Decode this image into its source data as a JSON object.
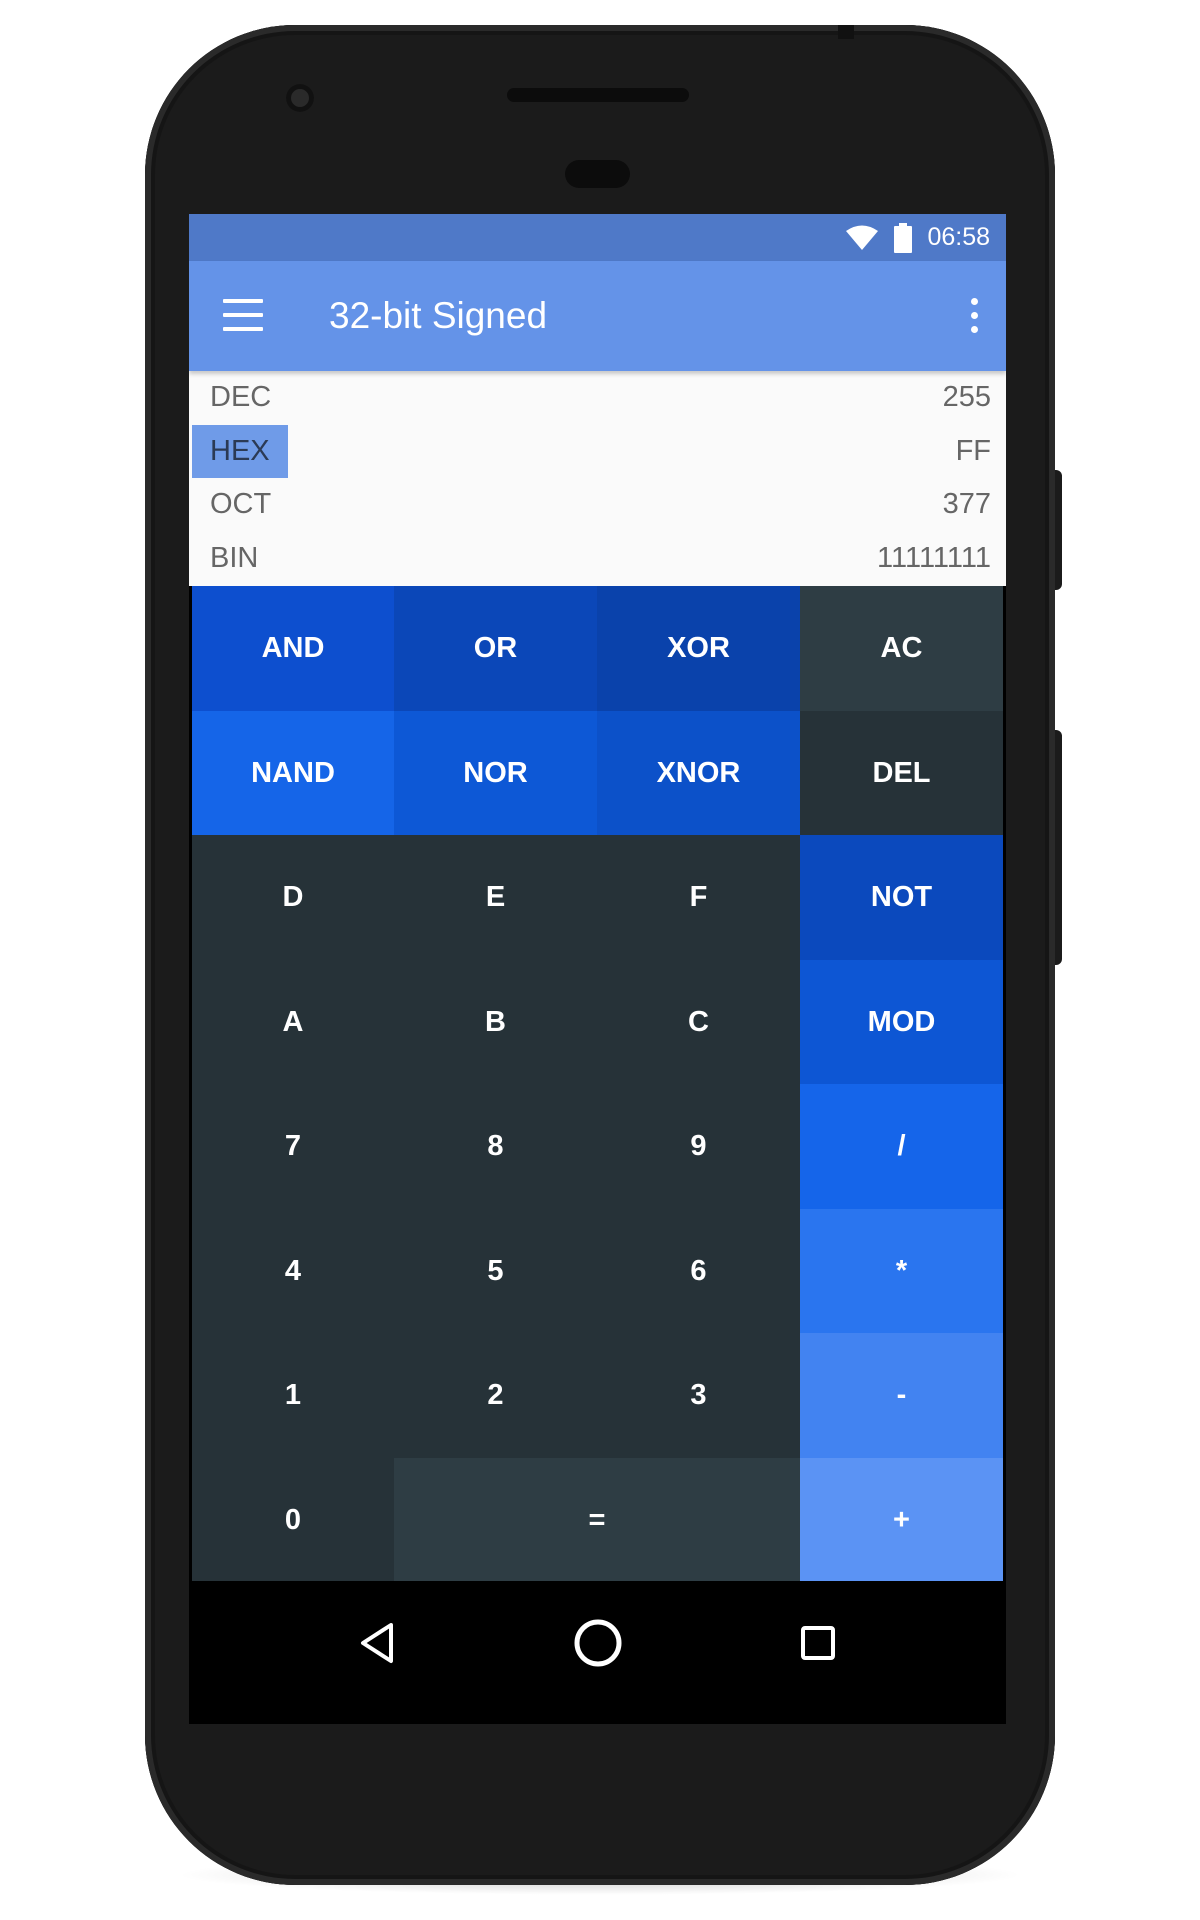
{
  "status_bar": {
    "time": "06:58",
    "icons": [
      "wifi-icon",
      "battery-icon"
    ],
    "background_color": "#4f79c8"
  },
  "app_bar": {
    "title": "32-bit Signed",
    "menu_icon": "hamburger-menu-icon",
    "overflow_icon": "more-vertical-icon",
    "background_color": "#6493e8"
  },
  "display": {
    "rows": [
      {
        "label": "DEC",
        "value": "255",
        "selected": false
      },
      {
        "label": "HEX",
        "value": "FF",
        "selected": true
      },
      {
        "label": "OCT",
        "value": "377",
        "selected": false
      },
      {
        "label": "BIN",
        "value": "11111111",
        "selected": false
      }
    ]
  },
  "keypad": {
    "rows": [
      {
        "keys": [
          {
            "label": "AND",
            "name": "and-key",
            "color": "#0d4fcf"
          },
          {
            "label": "OR",
            "name": "or-key",
            "color": "#0b47b8"
          },
          {
            "label": "XOR",
            "name": "xor-key",
            "color": "#0a42ab"
          },
          {
            "label": "AC",
            "name": "ac-key",
            "color": "#2e3d44"
          }
        ]
      },
      {
        "keys": [
          {
            "label": "NAND",
            "name": "nand-key",
            "color": "#1565e8"
          },
          {
            "label": "NOR",
            "name": "nor-key",
            "color": "#0d58d6"
          },
          {
            "label": "XNOR",
            "name": "xnor-key",
            "color": "#0c51c9"
          },
          {
            "label": "DEL",
            "name": "del-key",
            "color": "#263238"
          }
        ]
      },
      {
        "keys": [
          {
            "label": "D",
            "name": "d-key",
            "color": "#263238"
          },
          {
            "label": "E",
            "name": "e-key",
            "color": "#263238"
          },
          {
            "label": "F",
            "name": "f-key",
            "color": "#263238"
          },
          {
            "label": "NOT",
            "name": "not-key",
            "color": "#0b49bd"
          }
        ]
      },
      {
        "keys": [
          {
            "label": "A",
            "name": "a-key",
            "color": "#263238"
          },
          {
            "label": "B",
            "name": "b-key",
            "color": "#263238"
          },
          {
            "label": "C",
            "name": "c-key",
            "color": "#263238"
          },
          {
            "label": "MOD",
            "name": "mod-key",
            "color": "#0d56d4"
          }
        ]
      },
      {
        "keys": [
          {
            "label": "7",
            "name": "seven-key",
            "color": "#263238"
          },
          {
            "label": "8",
            "name": "eight-key",
            "color": "#263238"
          },
          {
            "label": "9",
            "name": "nine-key",
            "color": "#263238"
          },
          {
            "label": "/",
            "name": "divide-key",
            "color": "#1565ea"
          }
        ]
      },
      {
        "keys": [
          {
            "label": "4",
            "name": "four-key",
            "color": "#263238"
          },
          {
            "label": "5",
            "name": "five-key",
            "color": "#263238"
          },
          {
            "label": "6",
            "name": "six-key",
            "color": "#263238"
          },
          {
            "label": "*",
            "name": "multiply-key",
            "color": "#2a75ef"
          }
        ]
      },
      {
        "keys": [
          {
            "label": "1",
            "name": "one-key",
            "color": "#263238"
          },
          {
            "label": "2",
            "name": "two-key",
            "color": "#263238"
          },
          {
            "label": "3",
            "name": "three-key",
            "color": "#263238"
          },
          {
            "label": "-",
            "name": "minus-key",
            "color": "#4283f1"
          }
        ]
      },
      {
        "keys": [
          {
            "label": "0",
            "name": "zero-key",
            "color": "#263238"
          },
          {
            "label": "=",
            "name": "equals-key",
            "color": "#2e3d44",
            "span": 2
          },
          {
            "label": "+",
            "name": "plus-key",
            "color": "#5b93f4"
          }
        ]
      }
    ]
  },
  "nav_bar": {
    "buttons": [
      "back-icon",
      "home-icon",
      "recents-icon"
    ]
  }
}
